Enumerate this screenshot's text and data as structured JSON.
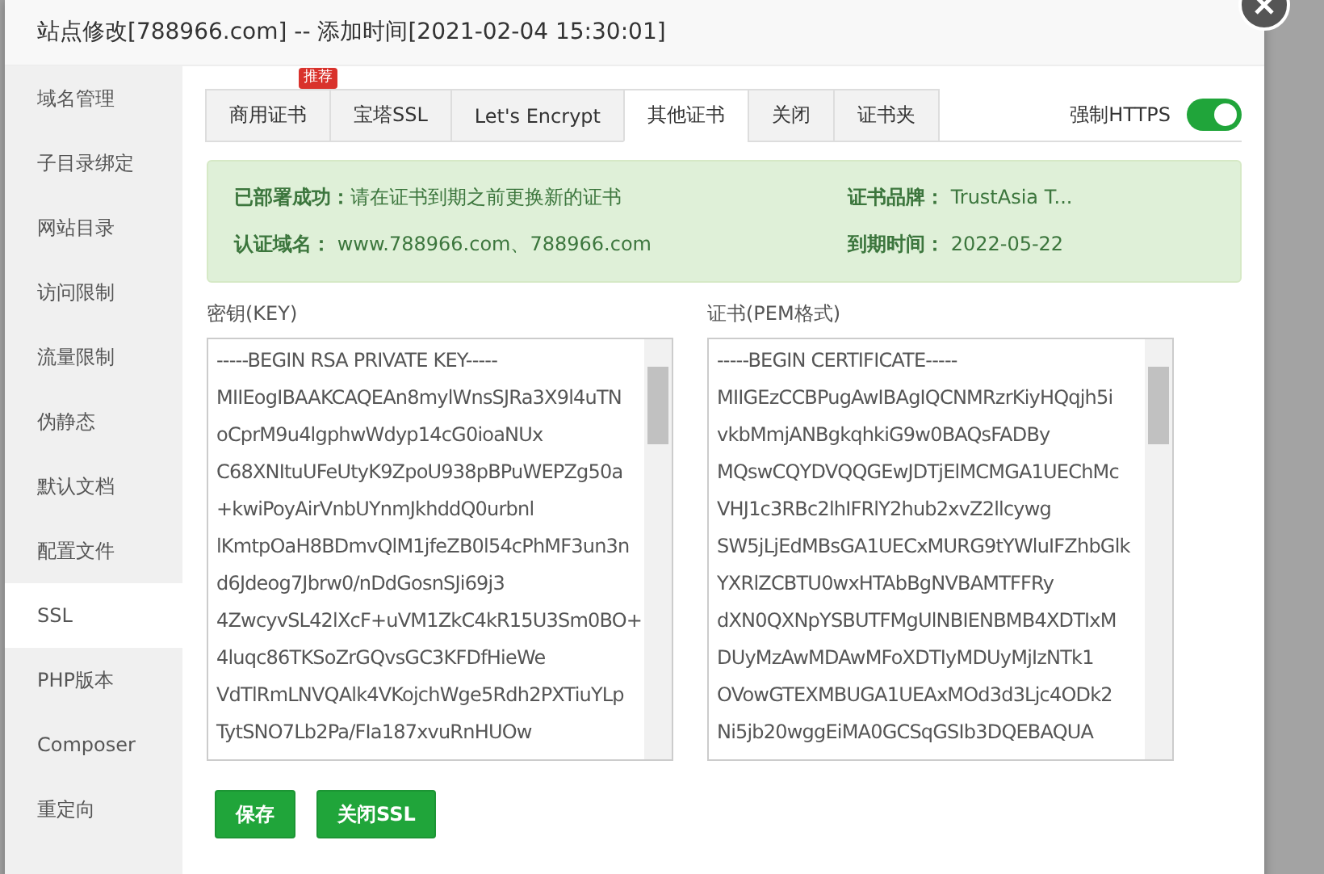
{
  "window": {
    "title": "站点修改[788966.com] -- 添加时间[2021-02-04 15:30:01]"
  },
  "sidebar": {
    "items": [
      {
        "label": "域名管理",
        "selected": false
      },
      {
        "label": "子目录绑定",
        "selected": false
      },
      {
        "label": "网站目录",
        "selected": false
      },
      {
        "label": "访问限制",
        "selected": false
      },
      {
        "label": "流量限制",
        "selected": false
      },
      {
        "label": "伪静态",
        "selected": false
      },
      {
        "label": "默认文档",
        "selected": false
      },
      {
        "label": "配置文件",
        "selected": false
      },
      {
        "label": "SSL",
        "selected": true
      },
      {
        "label": "PHP版本",
        "selected": false
      },
      {
        "label": "Composer",
        "selected": false
      },
      {
        "label": "重定向",
        "selected": false
      }
    ]
  },
  "tabs": [
    {
      "label": "商用证书",
      "selected": false,
      "badge": "推荐"
    },
    {
      "label": "宝塔SSL",
      "selected": false
    },
    {
      "label": "Let's Encrypt",
      "selected": false
    },
    {
      "label": "其他证书",
      "selected": true
    },
    {
      "label": "关闭",
      "selected": false
    },
    {
      "label": "证书夹",
      "selected": false
    }
  ],
  "force_https": {
    "label": "强制HTTPS",
    "on": true
  },
  "status": {
    "deployed_label": "已部署成功：",
    "deployed_text": "请在证书到期之前更换新的证书",
    "domain_label": "认证域名：",
    "domain_value": "www.788966.com、788966.com",
    "brand_label": "证书品牌：",
    "brand_value": "TrustAsia T...",
    "expiry_label": "到期时间：",
    "expiry_value": "2022-05-22"
  },
  "key_field": {
    "label": "密钥(KEY)",
    "lines": [
      "-----BEGIN RSA PRIVATE KEY-----",
      "MIIEogIBAAKCAQEAn8mylWnsSJRa3X9l4uTN",
      "oCprM9u4lgphwWdyp14cG0ioaNUx",
      "C68XNItuUFeUtyK9ZpoU938pBPuWEPZg50a",
      "+kwiPoyAirVnbUYnmJkhddQ0urbnl",
      "lKmtpOaH8BDmvQlM1jfeZB0l54cPhMF3un3n",
      "d6Jdeog7Jbrw0/nDdGosnSJi69j3",
      "4ZwcyvSL42lXcF+uVM1ZkC4kR15U3Sm0BO+",
      "4luqc86TKSoZrGQvsGC3KFDfHieWe",
      "VdTlRmLNVQAlk4VKojchWge5Rdh2PXTiuYLp",
      "TytSNO7Lb2Pa/FIa187xvuRnHUOw"
    ]
  },
  "cert_field": {
    "label": "证书(PEM格式)",
    "lines": [
      "-----BEGIN CERTIFICATE-----",
      "MIIGEzCCBPugAwIBAgIQCNMRzrKiyHQqjh5i",
      "vkbMmjANBgkqhkiG9w0BAQsFADBy",
      "MQswCQYDVQQGEwJDTjElMCMGA1UEChMc",
      "VHJ1c3RBc2lhIFRlY2hub2xvZ2llcywg",
      "SW5jLjEdMBsGA1UECxMURG9tYWluIFZhbGlk",
      "YXRlZCBTU0wxHTAbBgNVBAMTFFRy",
      "dXN0QXNpYSBUTFMgUlNBIENBMB4XDTIxM",
      "DUyMzAwMDAwMFoXDTIyMDUyMjIzNTk1",
      "OVowGTEXMBUGA1UEAxMOd3d3Ljc4ODk2",
      "Ni5jb20wggEiMA0GCSqGSIb3DQEBAQUA"
    ]
  },
  "buttons": [
    "保存",
    "关闭SSL"
  ]
}
